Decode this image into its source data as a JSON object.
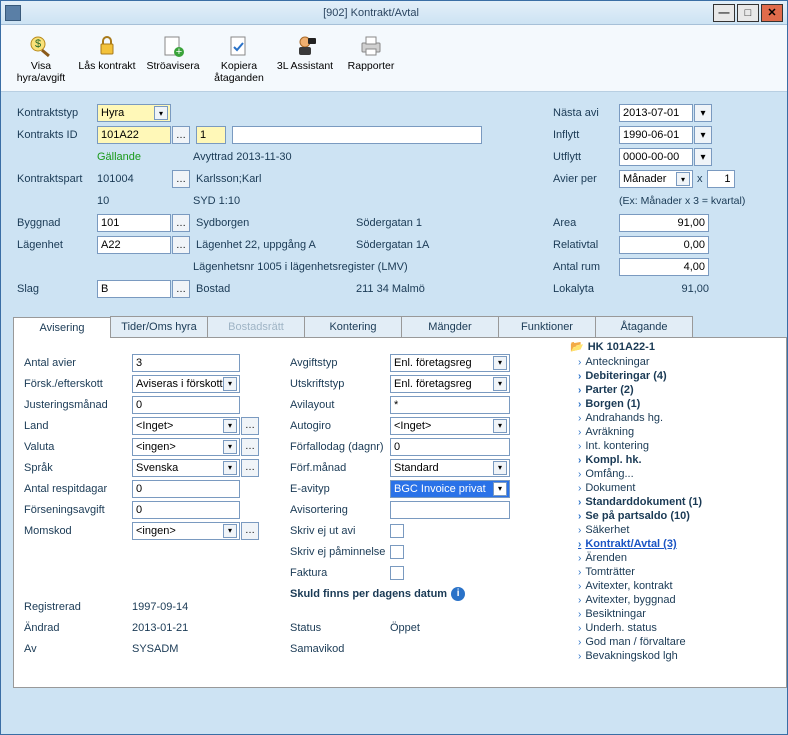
{
  "window": {
    "title": "[902]  Kontrakt/Avtal"
  },
  "toolbar": {
    "visa": "Visa hyra/avgift",
    "las": "Lås kontrakt",
    "stro": "Ströavisera",
    "kopiera": "Kopiera åtaganden",
    "assist": "3L Assistant",
    "rapporter": "Rapporter"
  },
  "labels": {
    "kontraktstyp": "Kontraktstyp",
    "kontrakts_id": "Kontrakts ID",
    "kontraktspart": "Kontraktspart",
    "byggnad": "Byggnad",
    "lagenhet": "Lägenhet",
    "slag": "Slag",
    "gallande": "Gällande",
    "avyttrad": "Avyttrad 2013-11-30",
    "nasta_avi": "Nästa avi",
    "inflytt": "Inflytt",
    "utflytt": "Utflytt",
    "avier_per": "Avier per",
    "avier_ex": "(Ex: Månader x 3 = kvartal)",
    "x": "x",
    "area": "Area",
    "relativtal": "Relativtal",
    "antal_rum": "Antal rum",
    "lokalyta": "Lokalyta"
  },
  "main": {
    "kontraktstyp": "Hyra",
    "kontrakts_id": "101A22",
    "kontrakts_seq": "1",
    "part_id": "101004",
    "part_name": "Karlsson;Karl",
    "part_sub": "10",
    "part_code": "SYD 1:10",
    "byggnad": "101",
    "byggnad_name": "Sydborgen",
    "byggnad_addr": "Södergatan 1",
    "lagenhet": "A22",
    "lagenhet_name": "Lägenhet 22, uppgång A",
    "lagenhet_addr": "Södergatan 1A",
    "lagenhet_reg": "Lägenhetsnr 1005 i lägenhetsregister (LMV)",
    "slag": "B",
    "slag_name": "Bostad",
    "slag_post": "211 34 Malmö"
  },
  "right": {
    "nasta_avi": "2013-07-01",
    "inflytt": "1990-06-01",
    "utflytt": "0000-00-00",
    "avier_per": "Månader",
    "avier_mult": "1",
    "area": "91,00",
    "relativtal": "0,00",
    "antal_rum": "4,00",
    "lokalyta": "91,00"
  },
  "tabs": {
    "avisering": "Avisering",
    "tider": "Tider/Oms hyra",
    "bostad": "Bostadsrätt",
    "kontering": "Kontering",
    "mangder": "Mängder",
    "funktioner": "Funktioner",
    "atagande": "Åtagande"
  },
  "avis_labels": {
    "antal_avier": "Antal avier",
    "forsk": "Försk./efterskott",
    "just": "Justeringsmånad",
    "land": "Land",
    "valuta": "Valuta",
    "sprak": "Språk",
    "respit": "Antal respitdagar",
    "forsen": "Förseningsavgift",
    "momskod": "Momskod",
    "avgiftstyp": "Avgiftstyp",
    "utskriftstyp": "Utskriftstyp",
    "avilayout": "Avilayout",
    "autogiro": "Autogiro",
    "forfallodag": "Förfallodag (dagnr)",
    "forfmanad": "Förf.månad",
    "eavityp": "E-avityp",
    "avisort": "Avisortering",
    "skrivavi": "Skriv ej ut avi",
    "skrivpam": "Skriv ej påminnelse",
    "faktura": "Faktura",
    "skuld": "Skuld finns per dagens datum",
    "registrerad": "Registrerad",
    "andrad": "Ändrad",
    "av": "Av",
    "status": "Status",
    "samavikod": "Samavikod"
  },
  "avis": {
    "antal_avier": "3",
    "forsk": "Aviseras i förskott",
    "just": "0",
    "land": "<Inget>",
    "valuta": "<ingen>",
    "sprak": "Svenska",
    "respit": "0",
    "forsen": "0",
    "momskod": "<ingen>",
    "avgiftstyp": "Enl. företagsreg",
    "utskriftstyp": "Enl. företagsreg",
    "avilayout": "*",
    "autogiro": "<Inget>",
    "forfallodag": "0",
    "forfmanad": "Standard",
    "eavityp": "BGC Invoice privat",
    "avisort": "",
    "registrerad": "1997-09-14",
    "andrad": "2013-01-21",
    "av": "SYSADM",
    "status": "Öppet",
    "samavikod": ""
  },
  "tree": {
    "root": "HK 101A22-1",
    "items": [
      {
        "label": "Anteckningar",
        "bold": false
      },
      {
        "label": "Debiteringar (4)",
        "bold": true
      },
      {
        "label": "Parter (2)",
        "bold": true
      },
      {
        "label": "Borgen (1)",
        "bold": true
      },
      {
        "label": "Andrahands hg.",
        "bold": false
      },
      {
        "label": "Avräkning",
        "bold": false
      },
      {
        "label": "Int. kontering",
        "bold": false
      },
      {
        "label": "Kompl. hk.",
        "bold": true
      },
      {
        "label": "Omfång...",
        "bold": false
      },
      {
        "label": "Dokument",
        "bold": false
      },
      {
        "label": "Standarddokument (1)",
        "bold": true
      },
      {
        "label": "Se på partsaldo (10)",
        "bold": true
      },
      {
        "label": "Säkerhet",
        "bold": false
      },
      {
        "label": "Kontrakt/Avtal (3)",
        "bold": true,
        "link": true
      },
      {
        "label": "Ärenden",
        "bold": false
      },
      {
        "label": "Tomträtter",
        "bold": false
      },
      {
        "label": "Avitexter, kontrakt",
        "bold": false
      },
      {
        "label": "Avitexter, byggnad",
        "bold": false
      },
      {
        "label": "Besiktningar",
        "bold": false
      },
      {
        "label": "Underh. status",
        "bold": false
      },
      {
        "label": "God man / förvaltare",
        "bold": false
      },
      {
        "label": "Bevakningskod lgh",
        "bold": false
      }
    ]
  }
}
